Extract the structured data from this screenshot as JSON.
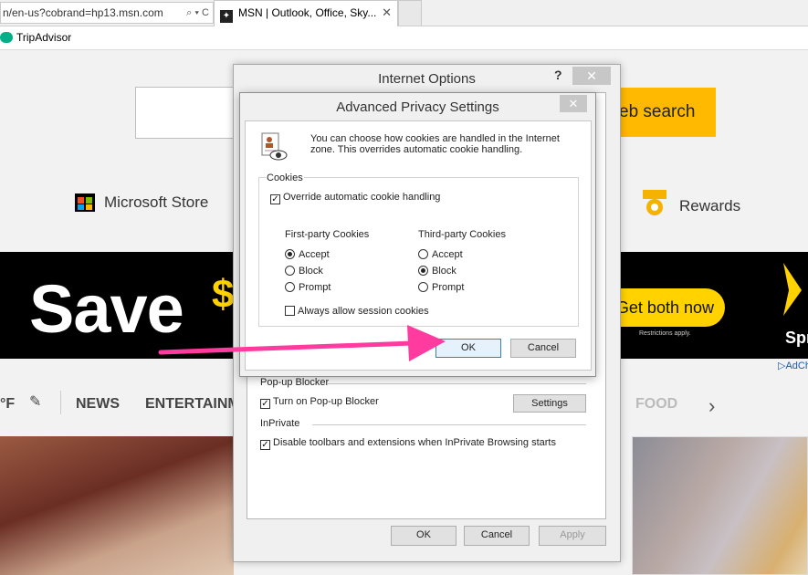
{
  "browser": {
    "address_url": "n/en-us?cobrand=hp13.msn.com",
    "address_icons": "⌕ ▾ C",
    "tab_title": "MSN | Outlook, Office, Sky...",
    "tab_close": "✕",
    "favorite": "TripAdvisor"
  },
  "page": {
    "search_button": "eb search",
    "microsoft_store": "Microsoft Store",
    "rewards": "Rewards",
    "ad": {
      "save": "Save",
      "dollar": "$",
      "cta": "Get both now",
      "restrictions": "Restrictions apply.",
      "brand": "Spr",
      "adchoices": "AdCh"
    },
    "nav": {
      "temperature": "°F",
      "news": "NEWS",
      "entertainment": "ENTERTAINMENT",
      "food": "FOOD"
    }
  },
  "internet_options": {
    "title": "Internet Options",
    "help": "?",
    "close": "✕",
    "popup_blocker_label": "Pop-up Blocker",
    "popup_blocker_check": "Turn on Pop-up Blocker",
    "popup_blocker_checked": true,
    "settings_button": "Settings",
    "inprivate_label": "InPrivate",
    "inprivate_check": "Disable toolbars and extensions when InPrivate Browsing starts",
    "inprivate_checked": true,
    "ok": "OK",
    "cancel": "Cancel",
    "apply": "Apply"
  },
  "advanced_privacy": {
    "title": "Advanced Privacy Settings",
    "close": "✕",
    "description": "You can choose how cookies are handled in the Internet zone.  This overrides automatic cookie handling.",
    "cookies_group": "Cookies",
    "override_label": "Override automatic cookie handling",
    "override_checked": true,
    "first_party": {
      "label": "First-party Cookies",
      "options": [
        "Accept",
        "Block",
        "Prompt"
      ],
      "selected": "Accept"
    },
    "third_party": {
      "label": "Third-party Cookies",
      "options": [
        "Accept",
        "Block",
        "Prompt"
      ],
      "selected": "Block"
    },
    "always_allow_session": "Always allow session cookies",
    "always_allow_checked": false,
    "ok": "OK",
    "cancel": "Cancel"
  },
  "colors": {
    "arrow": "#ff3ba0",
    "search_button": "#ffb900",
    "ad_yellow": "#ffd200"
  }
}
